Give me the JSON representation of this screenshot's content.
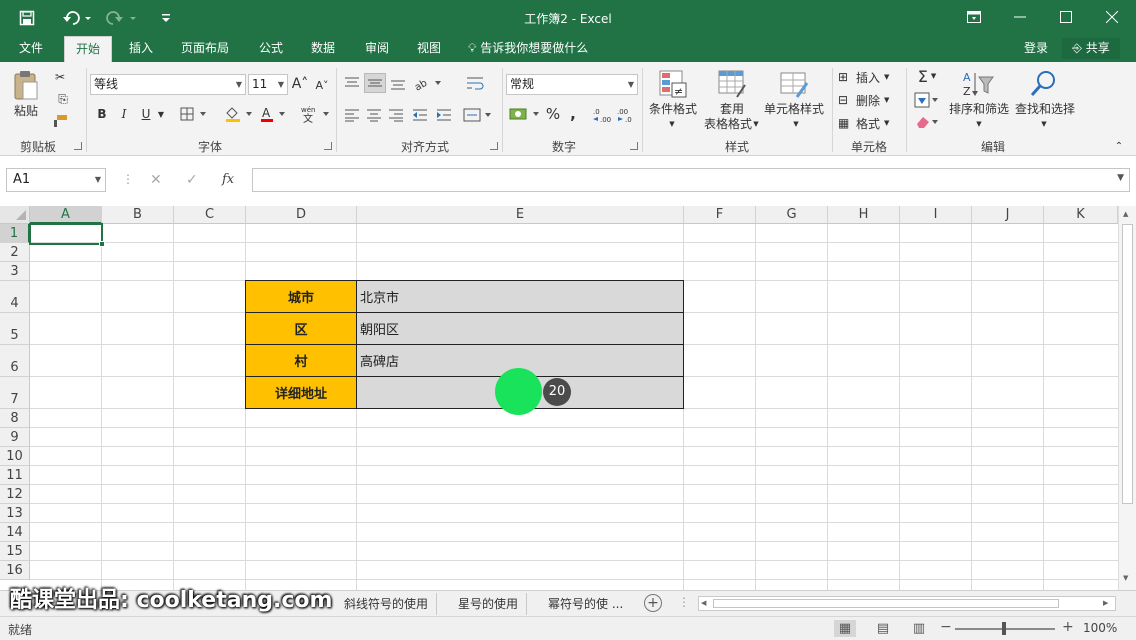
{
  "window": {
    "title": "工作簿2 - Excel",
    "qat": {
      "save_icon": "save-icon",
      "undo_icon": "undo-icon",
      "redo_icon": "redo-icon",
      "customize_icon": "customize-icon"
    }
  },
  "tabs": [
    "文件",
    "开始",
    "插入",
    "页面布局",
    "公式",
    "数据",
    "审阅",
    "视图"
  ],
  "active_tab": "开始",
  "tell_me": "告诉我你想要做什么",
  "login": "登录",
  "share": "共享",
  "ribbon": {
    "clipboard": {
      "label": "剪贴板",
      "paste": "粘贴"
    },
    "font": {
      "label": "字体",
      "name": "等线",
      "size": "11",
      "bold": "B",
      "italic": "I",
      "underline": "U"
    },
    "alignment": {
      "label": "对齐方式"
    },
    "number": {
      "label": "数字",
      "format": "常规",
      "percent": "%"
    },
    "styles": {
      "label": "样式",
      "conditional": "条件格式",
      "table_line1": "套用",
      "table_line2": "表格格式",
      "cell_styles": "单元格样式"
    },
    "cells": {
      "label": "单元格",
      "insert": "插入",
      "delete": "删除",
      "format": "格式"
    },
    "editing": {
      "label": "编辑",
      "sort": "排序和筛选",
      "find": "查找和选择"
    }
  },
  "formula_bar": {
    "name_box": "A1",
    "fx": "fx",
    "value": ""
  },
  "columns": [
    "A",
    "B",
    "C",
    "D",
    "E",
    "F",
    "G",
    "H",
    "I",
    "J",
    "K"
  ],
  "rows": [
    "1",
    "2",
    "3",
    "4",
    "5",
    "6",
    "7",
    "8",
    "9",
    "10",
    "11",
    "12",
    "13",
    "14",
    "15",
    "16"
  ],
  "selected_cell": "A1",
  "table": [
    {
      "label": "城市",
      "value": "北京市"
    },
    {
      "label": "区",
      "value": "朝阳区"
    },
    {
      "label": "村",
      "value": "高碑店"
    },
    {
      "label": "详细地址",
      "value": ""
    }
  ],
  "cursor_badge": "20",
  "watermark": "酷课堂出品: coolketang.com",
  "sheets": [
    "斜线符号的使用",
    "星号的使用",
    "幂符号的使 ..."
  ],
  "status": "就绪",
  "zoom": "100%",
  "colors": {
    "excel_green": "#217346",
    "label_fill": "#ffc000",
    "value_fill": "#d9d9d9"
  }
}
